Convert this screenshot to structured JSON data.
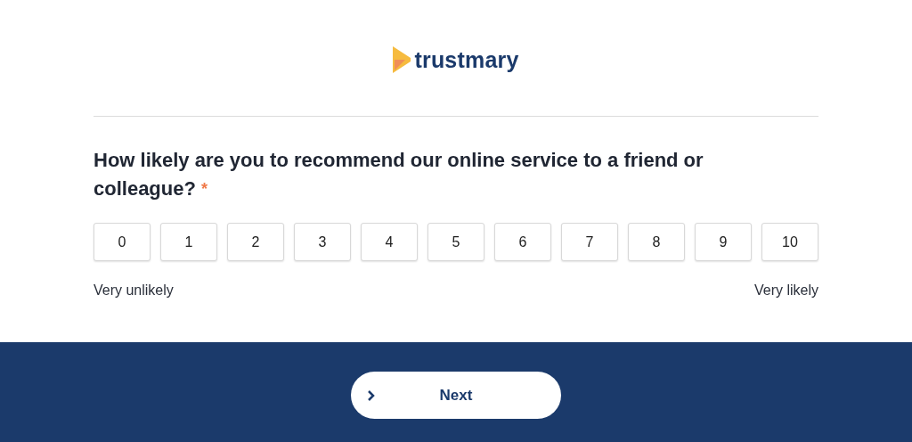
{
  "logo": {
    "text": "trustmary"
  },
  "question": {
    "text": "How likely are you to recommend our online service to a friend or colleague?",
    "required_mark": "*"
  },
  "scale": [
    {
      "label": "0",
      "selected": false
    },
    {
      "label": "1",
      "selected": false
    },
    {
      "label": "2",
      "selected": false
    },
    {
      "label": "3",
      "selected": false
    },
    {
      "label": "4",
      "selected": false
    },
    {
      "label": "5",
      "selected": false
    },
    {
      "label": "6",
      "selected": false
    },
    {
      "label": "7",
      "selected": false
    },
    {
      "label": "8",
      "selected": false
    },
    {
      "label": "9",
      "selected": false
    },
    {
      "label": "10",
      "selected": false
    }
  ],
  "scale_labels": {
    "low": "Very unlikely",
    "high": "Very likely"
  },
  "footer": {
    "button": "Next"
  }
}
